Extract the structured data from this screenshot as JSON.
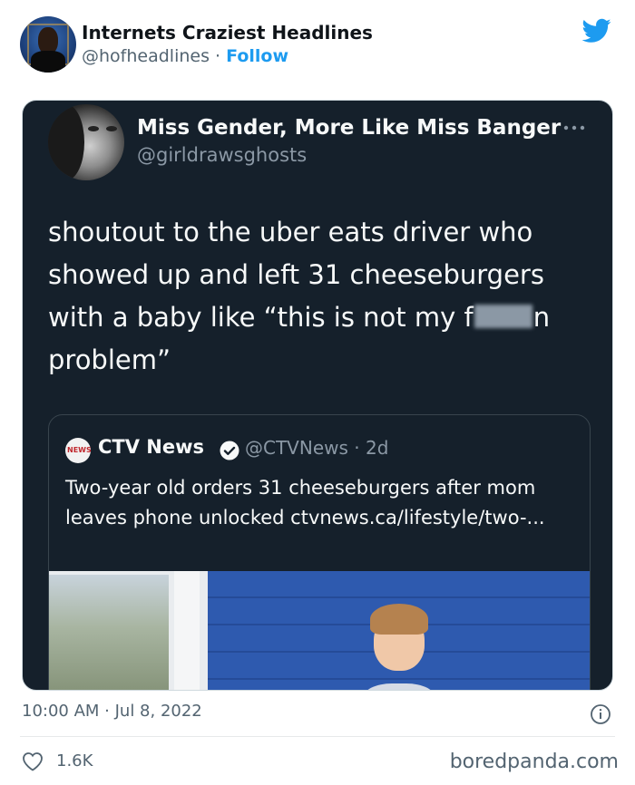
{
  "author": {
    "name": "Internets Craziest Headlines",
    "handle": "@hofheadlines",
    "separator": "·",
    "follow_label": "Follow",
    "avatar_icon": "person-avatar"
  },
  "embedded_tweet": {
    "author_name": "Miss Gender, More Like Miss Banger",
    "author_handle": "@girldrawsghosts",
    "text_before_censor": "shoutout to the uber eats driver who showed up and left 31 cheeseburgers with a baby like “this is not my f",
    "text_after_censor": "n problem”",
    "quoted": {
      "logo_text": "NEWS",
      "name": "CTV News",
      "handle_time": "@CTVNews · 2d",
      "text": "Two-year old orders 31 cheeseburgers after mom leaves phone unlocked ctvnews.ca/lifestyle/two-..."
    }
  },
  "footer": {
    "timestamp": "10:00 AM · Jul 8, 2022",
    "like_count": "1.6K",
    "watermark": "boredpanda.com"
  },
  "colors": {
    "twitter_blue": "#1d9bf0",
    "dark_bg": "#15202b",
    "muted_text": "#536471"
  }
}
